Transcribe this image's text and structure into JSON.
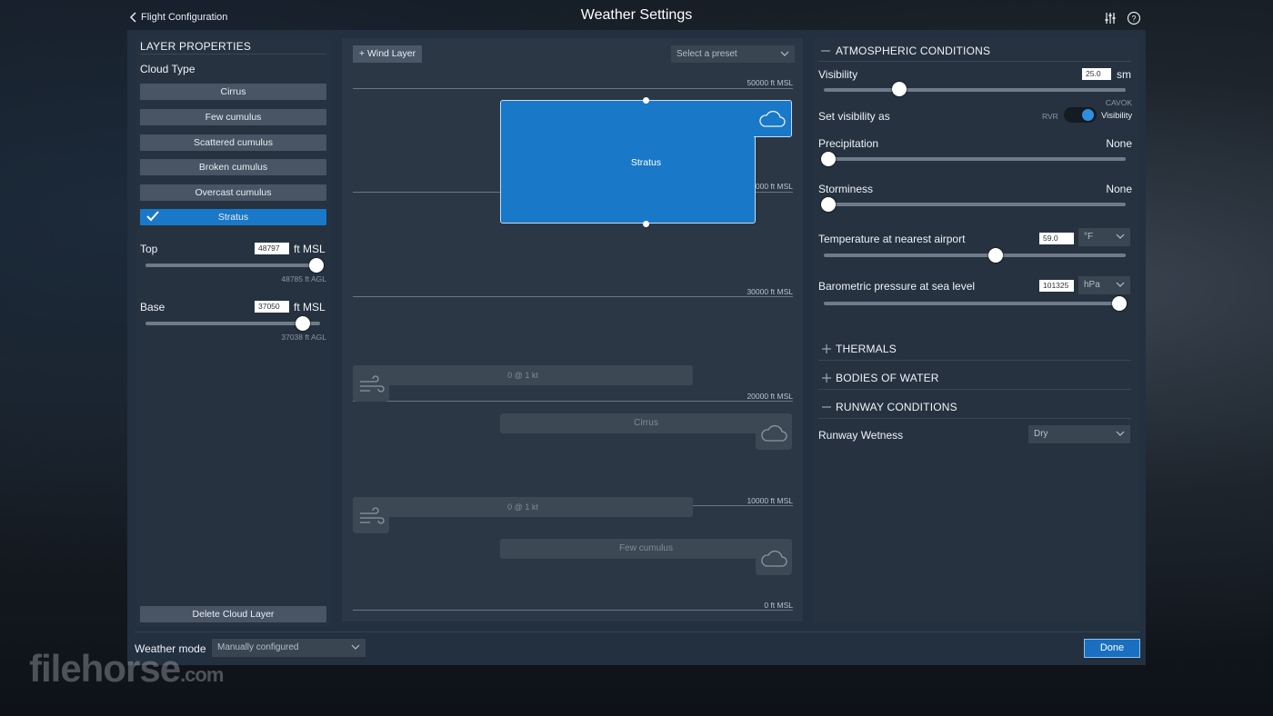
{
  "header": {
    "back_label": "Flight Configuration",
    "title": "Weather Settings",
    "icons": [
      "sliders-icon",
      "help-icon"
    ]
  },
  "layer_properties": {
    "title": "LAYER PROPERTIES",
    "cloud_type_label": "Cloud Type",
    "cloud_types": [
      "Cirrus",
      "Few cumulus",
      "Scattered cumulus",
      "Broken cumulus",
      "Overcast cumulus",
      "Stratus"
    ],
    "selected": "Stratus",
    "top": {
      "label": "Top",
      "value": "48797",
      "unit": "ft MSL",
      "agl": "48785 ft AGL",
      "fraction": 0.98
    },
    "base": {
      "label": "Base",
      "value": "37050",
      "unit": "ft MSL",
      "agl": "37038 ft AGL",
      "fraction": 0.9
    },
    "delete_label": "Delete Cloud Layer"
  },
  "timeline": {
    "add_wind_label": "+ Wind Layer",
    "preset_placeholder": "Select a preset",
    "altitudes": [
      "50000 ft MSL",
      "000 ft MSL",
      "30000 ft MSL",
      "20000 ft MSL",
      "10000 ft MSL",
      "0 ft MSL"
    ],
    "stratus_label": "Stratus",
    "wind_layers": [
      "0 @ 1 kt",
      "0 @ 1 kt"
    ],
    "cloud_layers": [
      "Cirrus",
      "Few cumulus"
    ]
  },
  "atmospheric": {
    "title": "ATMOSPHERIC CONDITIONS",
    "visibility": {
      "label": "Visibility",
      "value": "25.0",
      "unit": "sm",
      "cavok": "CAVOK",
      "fraction": 0.25
    },
    "set_visibility": {
      "label": "Set visibility as",
      "left": "RVR",
      "right": "Visibility"
    },
    "precipitation": {
      "label": "Precipitation",
      "value": "None",
      "fraction": 0.0
    },
    "storminess": {
      "label": "Storminess",
      "value": "None",
      "fraction": 0.0
    },
    "temperature": {
      "label": "Temperature at nearest airport",
      "value": "59.0",
      "unit": "°F",
      "fraction": 0.57
    },
    "pressure": {
      "label": "Barometric pressure at sea level",
      "value": "101325",
      "unit": "hPa",
      "fraction": 0.98
    }
  },
  "sections": {
    "thermals": "THERMALS",
    "bodies_of_water": "BODIES OF WATER",
    "runway_conditions": "RUNWAY CONDITIONS"
  },
  "runway": {
    "label": "Runway Wetness",
    "value": "Dry"
  },
  "footer": {
    "weather_mode_label": "Weather mode",
    "weather_mode_value": "Manually configured",
    "done_label": "Done"
  },
  "watermark": {
    "main": "filehorse",
    "suffix": ".com"
  }
}
